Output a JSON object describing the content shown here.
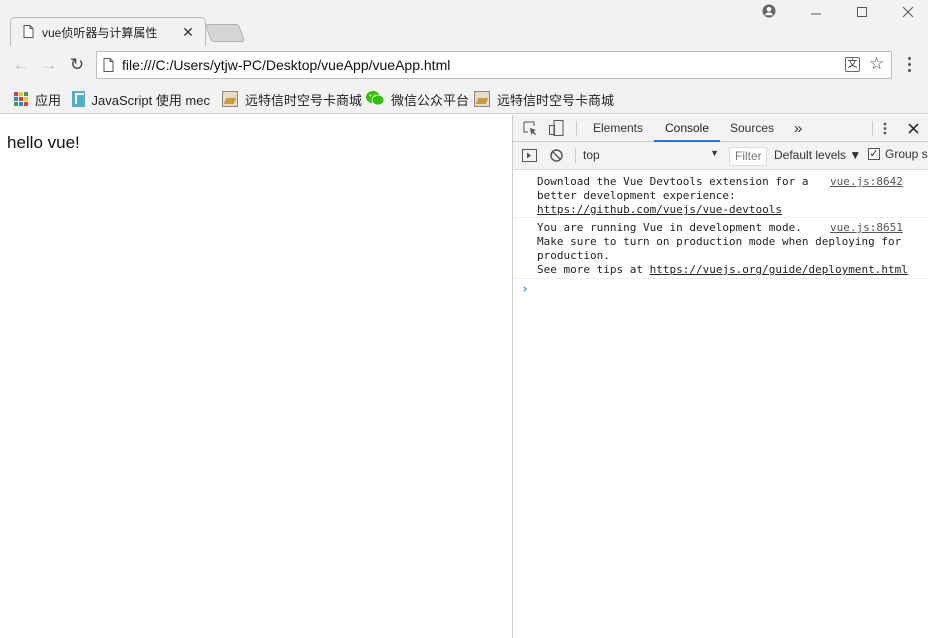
{
  "tab": {
    "title": "vue侦听器与计算属性",
    "close": "✕"
  },
  "window": {
    "profile": "●",
    "minimize": "—",
    "maximize": "☐",
    "close": "✕"
  },
  "toolbar": {
    "back": "←",
    "forward": "→",
    "reload": "↻",
    "url": "file:///C:/Users/ytjw-PC/Desktop/vueApp/vueApp.html",
    "translate": "文",
    "star": "☆"
  },
  "bookmarks": [
    {
      "label": "应用",
      "icon": "apps-grid-icon"
    },
    {
      "label": "JavaScript 使用 mec",
      "icon": "javascript-bookmark-icon"
    },
    {
      "label": "远特信时空号卡商城",
      "icon": "image-bookmark-icon"
    },
    {
      "label": "微信公众平台",
      "icon": "wechat-icon"
    },
    {
      "label": "远特信时空号卡商城",
      "icon": "image-bookmark-icon"
    }
  ],
  "page": {
    "text": "hello vue!"
  },
  "devtools": {
    "tabs": [
      "Elements",
      "Console",
      "Sources"
    ],
    "active_tab": "Console",
    "more": "»",
    "context": "top",
    "filter_placeholder": "Filter",
    "levels": "Default levels ▼",
    "group_similar": "Group si",
    "messages": [
      {
        "lines": [
          "Download the Vue Devtools extension for a",
          "better development experience:"
        ],
        "link": "https://github.com/vuejs/vue-devtools",
        "source": "vue.js:8642"
      },
      {
        "lines": [
          "You are running Vue in development mode.",
          "Make sure to turn on production mode when deploying for",
          "production."
        ],
        "tip_prefix": "See more tips at ",
        "link": "https://vuejs.org/guide/deployment.html",
        "source": "vue.js:8651"
      }
    ],
    "prompt": "›"
  },
  "colors": {
    "accent": "#1a73e8",
    "chrome_bg": "#f2f2f2",
    "devtools_bar": "#f3f3f3"
  }
}
